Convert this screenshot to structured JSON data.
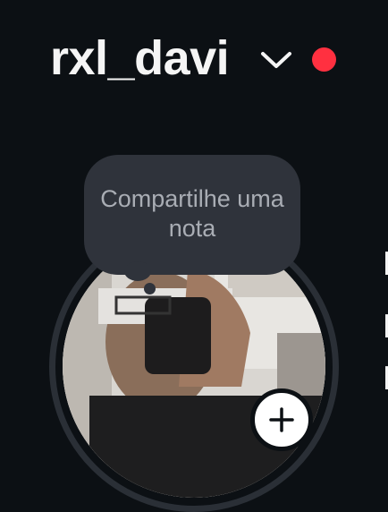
{
  "header": {
    "username": "rxl_davi",
    "switch_icon": "chevron-down-icon",
    "notification_color": "#ff3040"
  },
  "note": {
    "text": "Compartilhe uma nota"
  },
  "profile": {
    "add_icon": "plus-icon"
  },
  "colors": {
    "background": "#0c1014",
    "note_bubble": "#2f333b",
    "ring": "#2a2f36"
  }
}
